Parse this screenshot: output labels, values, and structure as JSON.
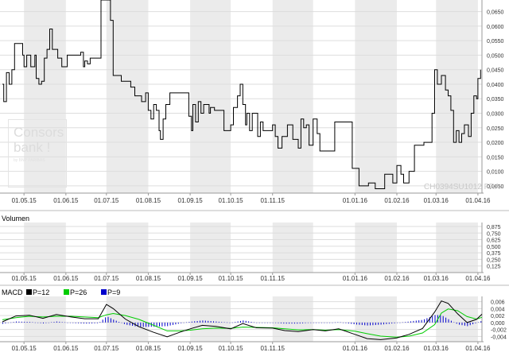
{
  "watermark": {
    "brand_line1": "Consors",
    "brand_line2": "bank !",
    "brand_sub": "by BNP PARIBAS",
    "security_code": "CH0394SU1012 FRA"
  },
  "chart_data": [
    {
      "type": "line",
      "title": "",
      "x_ticks": [
        "01.05.15",
        "01.06.15",
        "01.07.15",
        "01.08.15",
        "01.09.15",
        "01.10.15",
        "01.11.15",
        "01.01.16",
        "01.02.16",
        "01.03.16",
        "01.04.16"
      ],
      "y_ticks": [
        "0,0650",
        "0,0600",
        "0,0550",
        "0,0500",
        "0,0450",
        "0,0400",
        "0,0350",
        "0,0300",
        "0,0250",
        "0,0200",
        "0,0150",
        "0,0100",
        "0,0050"
      ],
      "ylim": [
        0.0025,
        0.069
      ],
      "series": [
        {
          "line_color": "#000000",
          "step": true,
          "points": [
            [
              "2015-04-15",
              0.04
            ],
            [
              "2015-04-16",
              0.034
            ],
            [
              "2015-04-18",
              0.044
            ],
            [
              "2015-04-20",
              0.04
            ],
            [
              "2015-04-22",
              0.045
            ],
            [
              "2015-04-24",
              0.054
            ],
            [
              "2015-04-30",
              0.05
            ],
            [
              "2015-05-01",
              0.046
            ],
            [
              "2015-05-03",
              0.05
            ],
            [
              "2015-05-06",
              0.046
            ],
            [
              "2015-05-09",
              0.05
            ],
            [
              "2015-05-10",
              0.042
            ],
            [
              "2015-05-12",
              0.04
            ],
            [
              "2015-05-14",
              0.041
            ],
            [
              "2015-05-16",
              0.049
            ],
            [
              "2015-05-18",
              0.052
            ],
            [
              "2015-05-20",
              0.059
            ],
            [
              "2015-05-22",
              0.052
            ],
            [
              "2015-05-26",
              0.049
            ],
            [
              "2015-05-29",
              0.046
            ],
            [
              "2015-06-02",
              0.05
            ],
            [
              "2015-06-12",
              0.051
            ],
            [
              "2015-06-14",
              0.046
            ],
            [
              "2015-06-15",
              0.048
            ],
            [
              "2015-06-17",
              0.047
            ],
            [
              "2015-06-19",
              0.049
            ],
            [
              "2015-06-27",
              0.069
            ],
            [
              "2015-07-04",
              0.062
            ],
            [
              "2015-07-06",
              0.043
            ],
            [
              "2015-07-12",
              0.041
            ],
            [
              "2015-07-19",
              0.039
            ],
            [
              "2015-07-22",
              0.036
            ],
            [
              "2015-07-27",
              0.034
            ],
            [
              "2015-07-30",
              0.037
            ],
            [
              "2015-08-01",
              0.031
            ],
            [
              "2015-08-03",
              0.028
            ],
            [
              "2015-08-05",
              0.033
            ],
            [
              "2015-08-07",
              0.031
            ],
            [
              "2015-08-09",
              0.024
            ],
            [
              "2015-08-10",
              0.021
            ],
            [
              "2015-08-12",
              0.028
            ],
            [
              "2015-08-14",
              0.033
            ],
            [
              "2015-08-17",
              0.037
            ],
            [
              "2015-08-31",
              0.029
            ],
            [
              "2015-09-02",
              0.024
            ],
            [
              "2015-09-03",
              0.033
            ],
            [
              "2015-09-05",
              0.027
            ],
            [
              "2015-09-07",
              0.034
            ],
            [
              "2015-09-09",
              0.03
            ],
            [
              "2015-09-11",
              0.033
            ],
            [
              "2015-09-13",
              0.033
            ],
            [
              "2015-09-15",
              0.03
            ],
            [
              "2015-09-16",
              0.032
            ],
            [
              "2015-09-19",
              0.031
            ],
            [
              "2015-09-26",
              0.024
            ],
            [
              "2015-10-01",
              0.026
            ],
            [
              "2015-10-03",
              0.032
            ],
            [
              "2015-10-06",
              0.036
            ],
            [
              "2015-10-08",
              0.04
            ],
            [
              "2015-10-10",
              0.033
            ],
            [
              "2015-10-12",
              0.026
            ],
            [
              "2015-10-13",
              0.03
            ],
            [
              "2015-10-15",
              0.024
            ],
            [
              "2015-10-17",
              0.03
            ],
            [
              "2015-10-21",
              0.022
            ],
            [
              "2015-10-23",
              0.027
            ],
            [
              "2015-10-25",
              0.024
            ],
            [
              "2015-11-01",
              0.026
            ],
            [
              "2015-11-03",
              0.022
            ],
            [
              "2015-11-05",
              0.018
            ],
            [
              "2015-11-08",
              0.022
            ],
            [
              "2015-11-12",
              0.026
            ],
            [
              "2015-11-16",
              0.021
            ],
            [
              "2015-11-20",
              0.018
            ],
            [
              "2015-11-22",
              0.028
            ],
            [
              "2015-11-24",
              0.025
            ],
            [
              "2015-11-26",
              0.026
            ],
            [
              "2015-11-28",
              0.019
            ],
            [
              "2015-12-01",
              0.028
            ],
            [
              "2015-12-04",
              0.023
            ],
            [
              "2015-12-06",
              0.017
            ],
            [
              "2015-12-17",
              0.027
            ],
            [
              "2015-12-30",
              0.011
            ],
            [
              "2016-01-04",
              0.005
            ],
            [
              "2016-01-11",
              0.006
            ],
            [
              "2016-01-16",
              0.004
            ],
            [
              "2016-01-23",
              0.009
            ],
            [
              "2016-01-29",
              0.006
            ],
            [
              "2016-02-01",
              0.012
            ],
            [
              "2016-02-04",
              0.009
            ],
            [
              "2016-02-06",
              0.006
            ],
            [
              "2016-02-10",
              0.01
            ],
            [
              "2016-02-14",
              0.019
            ],
            [
              "2016-02-21",
              0.02
            ],
            [
              "2016-02-27",
              0.03
            ],
            [
              "2016-02-29",
              0.045
            ],
            [
              "2016-03-02",
              0.04
            ],
            [
              "2016-03-05",
              0.043
            ],
            [
              "2016-03-08",
              0.038
            ],
            [
              "2016-03-10",
              0.036
            ],
            [
              "2016-03-12",
              0.031
            ],
            [
              "2016-03-14",
              0.02
            ],
            [
              "2016-03-16",
              0.024
            ],
            [
              "2016-03-18",
              0.02
            ],
            [
              "2016-03-20",
              0.023
            ],
            [
              "2016-03-22",
              0.026
            ],
            [
              "2016-03-25",
              0.022
            ],
            [
              "2016-03-27",
              0.03
            ],
            [
              "2016-03-29",
              0.036
            ],
            [
              "2016-03-31",
              0.035
            ],
            [
              "2016-04-01",
              0.042
            ],
            [
              "2016-04-03",
              0.045
            ]
          ]
        }
      ]
    },
    {
      "type": "bar",
      "title": "Volumen",
      "x_ticks": [
        "01.05.15",
        "01.06.15",
        "01.07.15",
        "01.08.15",
        "01.09.15",
        "01.10.15",
        "01.11.15",
        "01.01.16",
        "01.02.16",
        "01.03.16",
        "01.04.16"
      ],
      "y_ticks": [
        "0,875",
        "0,750",
        "0,625",
        "0,500",
        "0,375",
        "0,250",
        "0,125"
      ],
      "ylim": [
        0,
        0.95
      ],
      "values": []
    },
    {
      "type": "line",
      "title": "MACD",
      "x_ticks": [
        "01.05.15",
        "01.06.15",
        "01.07.15",
        "01.08.15",
        "01.09.15",
        "01.10.15",
        "01.11.15",
        "01.01.16",
        "01.02.16",
        "01.03.16",
        "01.04.16"
      ],
      "y_ticks": [
        "0,006",
        "0,004",
        "0,002",
        "0,000",
        "-0,002",
        "-0,004"
      ],
      "ylim": [
        -0.0055,
        0.0075
      ],
      "series": [
        {
          "name": "P=12",
          "color": "#000000",
          "points": [
            [
              "2015-04-15",
              0.0002
            ],
            [
              "2015-04-25",
              0.0019
            ],
            [
              "2015-05-05",
              0.0021
            ],
            [
              "2015-05-15",
              0.0012
            ],
            [
              "2015-05-25",
              0.0023
            ],
            [
              "2015-06-05",
              0.0016
            ],
            [
              "2015-06-15",
              0.0011
            ],
            [
              "2015-06-25",
              0.0011
            ],
            [
              "2015-07-01",
              0.0052
            ],
            [
              "2015-07-06",
              0.004
            ],
            [
              "2015-07-15",
              0.001
            ],
            [
              "2015-07-25",
              -0.0012
            ],
            [
              "2015-08-05",
              -0.0028
            ],
            [
              "2015-08-15",
              -0.0041
            ],
            [
              "2015-08-25",
              -0.0027
            ],
            [
              "2015-09-01",
              -0.0018
            ],
            [
              "2015-09-10",
              -0.0008
            ],
            [
              "2015-09-20",
              -0.0011
            ],
            [
              "2015-10-01",
              -0.0018
            ],
            [
              "2015-10-10",
              -0.0003
            ],
            [
              "2015-10-20",
              -0.0015
            ],
            [
              "2015-11-01",
              -0.0016
            ],
            [
              "2015-11-10",
              -0.0023
            ],
            [
              "2015-11-20",
              -0.0026
            ],
            [
              "2015-12-01",
              -0.002
            ],
            [
              "2015-12-10",
              -0.0024
            ],
            [
              "2015-12-20",
              -0.0018
            ],
            [
              "2016-01-01",
              -0.0034
            ],
            [
              "2016-01-10",
              -0.0046
            ],
            [
              "2016-01-20",
              -0.0049
            ],
            [
              "2016-02-01",
              -0.0044
            ],
            [
              "2016-02-10",
              -0.0034
            ],
            [
              "2016-02-20",
              -0.0017
            ],
            [
              "2016-02-29",
              0.003
            ],
            [
              "2016-03-05",
              0.0062
            ],
            [
              "2016-03-10",
              0.0055
            ],
            [
              "2016-03-17",
              0.0025
            ],
            [
              "2016-03-24",
              0.0
            ],
            [
              "2016-03-31",
              0.0009
            ],
            [
              "2016-04-04",
              0.0024
            ]
          ]
        },
        {
          "name": "P=26",
          "color": "#00cc00",
          "points": [
            [
              "2015-04-15",
              0.0008
            ],
            [
              "2015-04-25",
              0.0014
            ],
            [
              "2015-05-05",
              0.0018
            ],
            [
              "2015-05-15",
              0.0016
            ],
            [
              "2015-05-25",
              0.0018
            ],
            [
              "2015-06-05",
              0.0018
            ],
            [
              "2015-06-15",
              0.0016
            ],
            [
              "2015-06-25",
              0.0014
            ],
            [
              "2015-07-01",
              0.0022
            ],
            [
              "2015-07-06",
              0.0026
            ],
            [
              "2015-07-15",
              0.002
            ],
            [
              "2015-07-25",
              0.0009
            ],
            [
              "2015-08-05",
              -0.0008
            ],
            [
              "2015-08-15",
              -0.0024
            ],
            [
              "2015-08-25",
              -0.0024
            ],
            [
              "2015-09-01",
              -0.0022
            ],
            [
              "2015-09-10",
              -0.0018
            ],
            [
              "2015-09-20",
              -0.0016
            ],
            [
              "2015-10-01",
              -0.0017
            ],
            [
              "2015-10-10",
              -0.0013
            ],
            [
              "2015-10-20",
              -0.0014
            ],
            [
              "2015-11-01",
              -0.0015
            ],
            [
              "2015-11-10",
              -0.0018
            ],
            [
              "2015-11-20",
              -0.0021
            ],
            [
              "2015-12-01",
              -0.002
            ],
            [
              "2015-12-10",
              -0.0022
            ],
            [
              "2015-12-20",
              -0.002
            ],
            [
              "2016-01-01",
              -0.0025
            ],
            [
              "2016-01-10",
              -0.0032
            ],
            [
              "2016-01-20",
              -0.0039
            ],
            [
              "2016-02-01",
              -0.0042
            ],
            [
              "2016-02-10",
              -0.0039
            ],
            [
              "2016-02-20",
              -0.003
            ],
            [
              "2016-02-29",
              -0.0006
            ],
            [
              "2016-03-05",
              0.0027
            ],
            [
              "2016-03-10",
              0.0039
            ],
            [
              "2016-03-17",
              0.0034
            ],
            [
              "2016-03-24",
              0.0017
            ],
            [
              "2016-03-31",
              0.001
            ],
            [
              "2016-04-04",
              0.0015
            ]
          ]
        },
        {
          "name": "P=9",
          "color": "#0000cc",
          "type": "bar"
        }
      ]
    }
  ]
}
